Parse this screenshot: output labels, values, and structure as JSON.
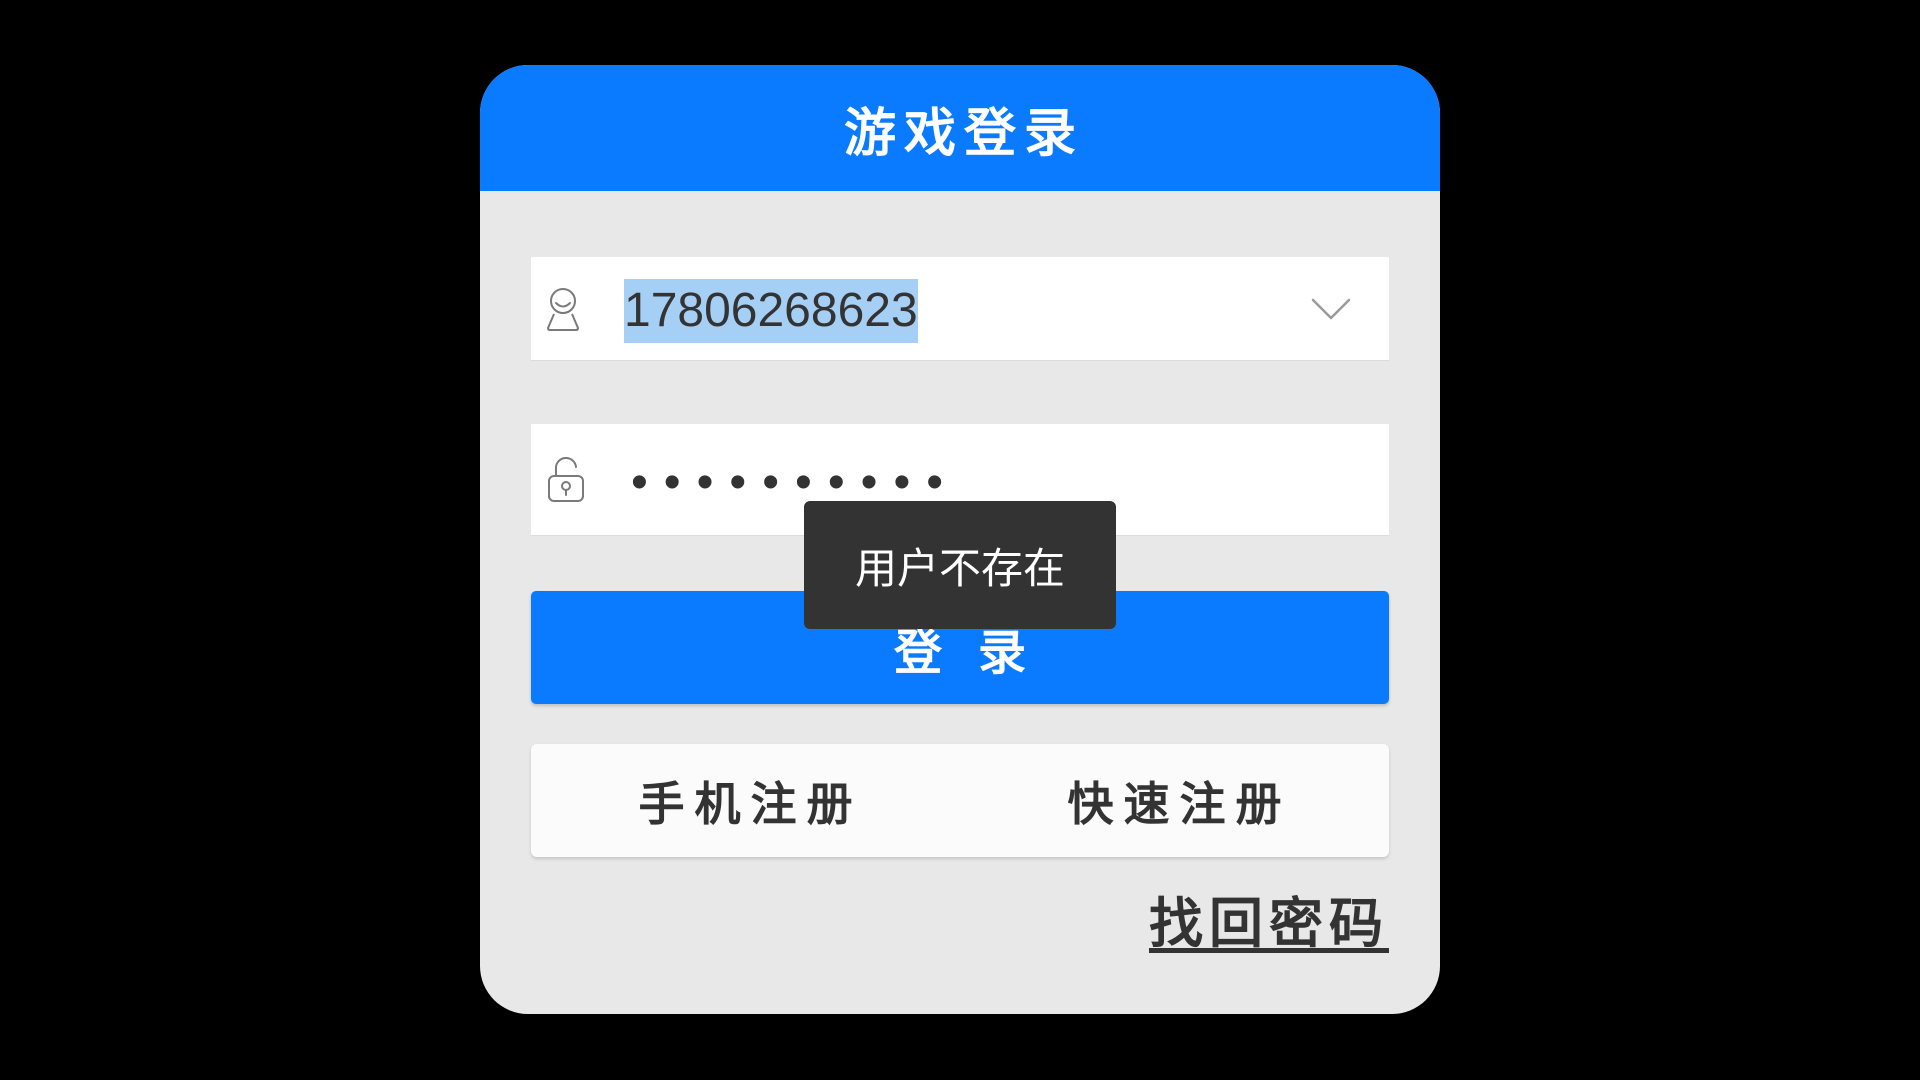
{
  "colors": {
    "background": "#000000",
    "card": "#e8e8e8",
    "header": "#0a7bff",
    "button": "#0a7bff",
    "selection": "#a6cff6",
    "toast": "#333333"
  },
  "header": {
    "title": "游戏登录"
  },
  "username": {
    "value": "17806268623",
    "icon": "user-icon",
    "dropdown_icon": "chevron-down-icon"
  },
  "password": {
    "masked_value": "••••••••••",
    "icon": "lock-icon"
  },
  "toast": {
    "message": "用户不存在"
  },
  "login_button": {
    "label": "登录"
  },
  "register": {
    "phone_label": "手机注册",
    "quick_label": "快速注册"
  },
  "recover_link": {
    "label": "找回密码"
  }
}
